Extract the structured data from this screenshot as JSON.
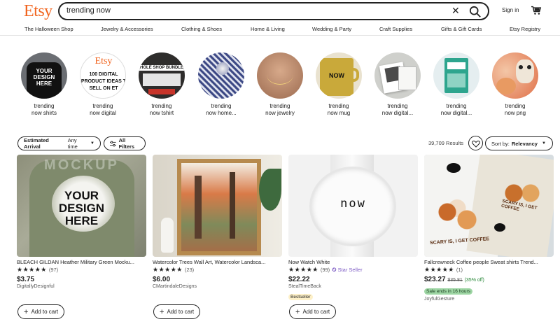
{
  "header": {
    "logo": "Etsy",
    "search_value": "trending now",
    "signin": "Sign in"
  },
  "nav": [
    "The Halloween Shop",
    "Jewelry & Accessories",
    "Clothing & Shoes",
    "Home & Living",
    "Wedding & Party",
    "Craft Supplies",
    "Gifts & Gift Cards",
    "Etsy Registry"
  ],
  "circles": [
    {
      "line1": "trending",
      "line2": "now shirts"
    },
    {
      "line1": "trending",
      "line2": "now digital"
    },
    {
      "line1": "trending",
      "line2": "now tshirt"
    },
    {
      "line1": "trending",
      "line2": "now home..."
    },
    {
      "line1": "trending",
      "line2": "now jewelry"
    },
    {
      "line1": "trending",
      "line2": "now mug"
    },
    {
      "line1": "trending",
      "line2": "now digital..."
    },
    {
      "line1": "trending",
      "line2": "now digital..."
    },
    {
      "line1": "trending",
      "line2": "now png"
    }
  ],
  "circle_texts": {
    "shirt": [
      "YOUR",
      "DESIGN",
      "HERE"
    ],
    "digital": [
      "Etsy",
      "100 DIGITAL",
      "PRODUCT IDEAS T",
      "SELL ON ET"
    ],
    "tshirt": "HOLE SHOP BUNDLE",
    "mug": "NOW"
  },
  "filters": {
    "arrival_label": "Estimated Arrival",
    "arrival_value": "Any time",
    "all_filters": "All Filters",
    "results": "39,709 Results",
    "sort_label": "Sort by:",
    "sort_value": "Relevancy"
  },
  "products": [
    {
      "title": "BLEACH GILDAN Heather Military Green Mocku...",
      "reviews": "(97)",
      "price": "$3.75",
      "shop": "DigitallyDesignful",
      "add": "Add to cart",
      "image_text": [
        "YOUR",
        "DESIGN",
        "HERE"
      ],
      "watermark": "MOCKUP"
    },
    {
      "title": "Watercolor Trees Wall Art, Watercolor Landsca...",
      "reviews": "(23)",
      "price": "$6.00",
      "shop": "CMartindaleDesigns",
      "add": "Add to cart"
    },
    {
      "title": "Now Watch White",
      "reviews": "(99)",
      "star_seller": "Star Seller",
      "price": "$22.22",
      "shop": "StealTimeBack",
      "badge": "Bestseller",
      "add": "Add to cart",
      "image_text": "now"
    },
    {
      "title": "Fallcrewneck Coffee people Sweat shirts Trend...",
      "reviews": "(1)",
      "price": "$23.27",
      "old_price": "$35.81",
      "discount": "(35% off)",
      "badge": "Sale ends in 16 hours",
      "shop": "JoyfulGesture",
      "image_text": [
        "SCARY IS, I GET COFFEE",
        "SCARY IS, I GET COFFEE"
      ]
    }
  ],
  "colors": {
    "brand": "#f1641e",
    "star_seller": "#7c5ac4",
    "bestseller_bg": "#fdf0c8",
    "sale_bg": "#9ed6a4",
    "discount": "#258635"
  }
}
